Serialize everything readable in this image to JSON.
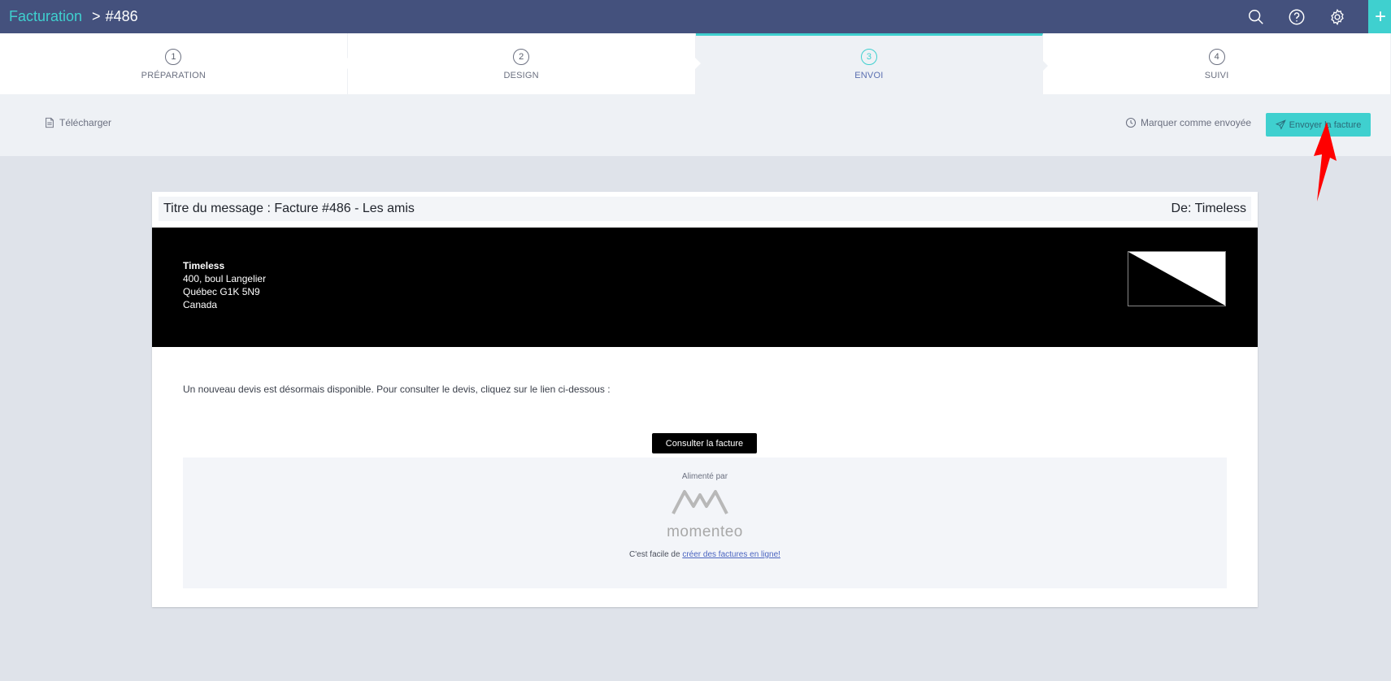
{
  "breadcrumb": {
    "root": "Facturation",
    "separator": ">",
    "current": "#486"
  },
  "topbar": {
    "plus_label": "+"
  },
  "steps": [
    {
      "number": "1",
      "label": "PRÉPARATION"
    },
    {
      "number": "2",
      "label": "DESIGN"
    },
    {
      "number": "3",
      "label": "ENVOI"
    },
    {
      "number": "4",
      "label": "SUIVI"
    }
  ],
  "actions": {
    "download_label": "Télécharger",
    "mark_sent_label": "Marquer comme envoyée",
    "send_label": "Envoyer la facture"
  },
  "email": {
    "subject": "Titre du message : Facture #486 - Les amis",
    "from": "De: Timeless",
    "company": {
      "name": "Timeless",
      "address1": "400, boul Langelier",
      "address2": "Québec G1K 5N9",
      "country": "Canada"
    },
    "message": "Un nouveau devis est désormais disponible. Pour consulter le devis, cliquez sur le lien ci-dessous :",
    "cta_label": "Consulter la facture",
    "footer": {
      "powered_by": "Alimenté par",
      "brand": "momenteo",
      "easy_text": "C'est facile de",
      "easy_link": "créer des factures en ligne!"
    }
  },
  "colors": {
    "topbar": "#44517d",
    "accent": "#3fd0cf",
    "annotation": "#ff0000"
  }
}
